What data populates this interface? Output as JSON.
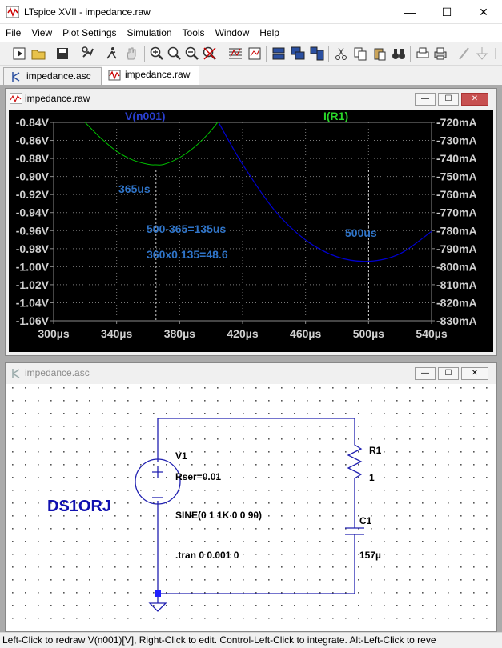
{
  "app": {
    "title": "LTspice XVII - impedance.raw",
    "min_glyph": "—",
    "max_glyph": "☐",
    "close_glyph": "✕"
  },
  "menu": [
    "File",
    "View",
    "Plot Settings",
    "Simulation",
    "Tools",
    "Window",
    "Help"
  ],
  "tabs": [
    {
      "label": "impedance.asc",
      "active": false
    },
    {
      "label": "impedance.raw",
      "active": true
    }
  ],
  "plot_window": {
    "title": "impedance.raw"
  },
  "schematic_window": {
    "title": "impedance.asc"
  },
  "chart_data": {
    "type": "line",
    "series": [
      {
        "name": "V(n001)",
        "color": "#00c000",
        "axis": "left",
        "x": [
          320,
          330,
          340,
          350,
          360,
          365,
          370,
          380,
          390,
          400,
          410
        ],
        "y": [
          -0.84,
          -0.8575,
          -0.872,
          -0.8815,
          -0.8865,
          -0.887,
          -0.8865,
          -0.879,
          -0.8665,
          -0.849,
          -0.8265
        ]
      },
      {
        "name": "I(R1)",
        "color": "#0000d0",
        "axis": "right",
        "x": [
          405,
          420,
          440,
          460,
          480,
          500,
          520,
          540
        ],
        "y": [
          -720.4,
          -743.2,
          -768.4,
          -785.2,
          -794.5,
          -797,
          -792.8,
          -780.4
        ]
      }
    ],
    "title_left": "V(n001)",
    "title_right": "I(R1)",
    "xlim": [
      300,
      540
    ],
    "xticks": [
      "300µs",
      "340µs",
      "380µs",
      "420µs",
      "460µs",
      "500µs",
      "540µs"
    ],
    "ylim_left": [
      -1.06,
      -0.84
    ],
    "yticks_left": [
      "-0.84V",
      "-0.86V",
      "-0.88V",
      "-0.90V",
      "-0.92V",
      "-0.94V",
      "-0.96V",
      "-0.98V",
      "-1.00V",
      "-1.02V",
      "-1.04V",
      "-1.06V"
    ],
    "ylim_right": [
      -830,
      -720
    ],
    "yticks_right": [
      "-720mA",
      "-730mA",
      "-740mA",
      "-750mA",
      "-760mA",
      "-770mA",
      "-780mA",
      "-790mA",
      "-800mA",
      "-810mA",
      "-820mA",
      "-830mA"
    ],
    "grid": true,
    "markers": [
      365,
      500
    ],
    "annotations": [
      "365us",
      "500us",
      "500-365=135us",
      "360x0.135=48.6"
    ]
  },
  "schematic": {
    "v1_name": "V1",
    "v1_rser": "Rser=0.01",
    "v1_sine": "SINE(0 1 1K 0 0 90)",
    "tran": ".tran 0 0.001 0",
    "r1_name": "R1",
    "r1_value": "1",
    "c1_name": "C1",
    "c1_value": "157µ",
    "watermark": "DS1ORJ"
  },
  "status": "Left-Click to redraw V(n001)[V],  Right-Click to edit. Control-Left-Click to integrate. Alt-Left-Click to reve"
}
